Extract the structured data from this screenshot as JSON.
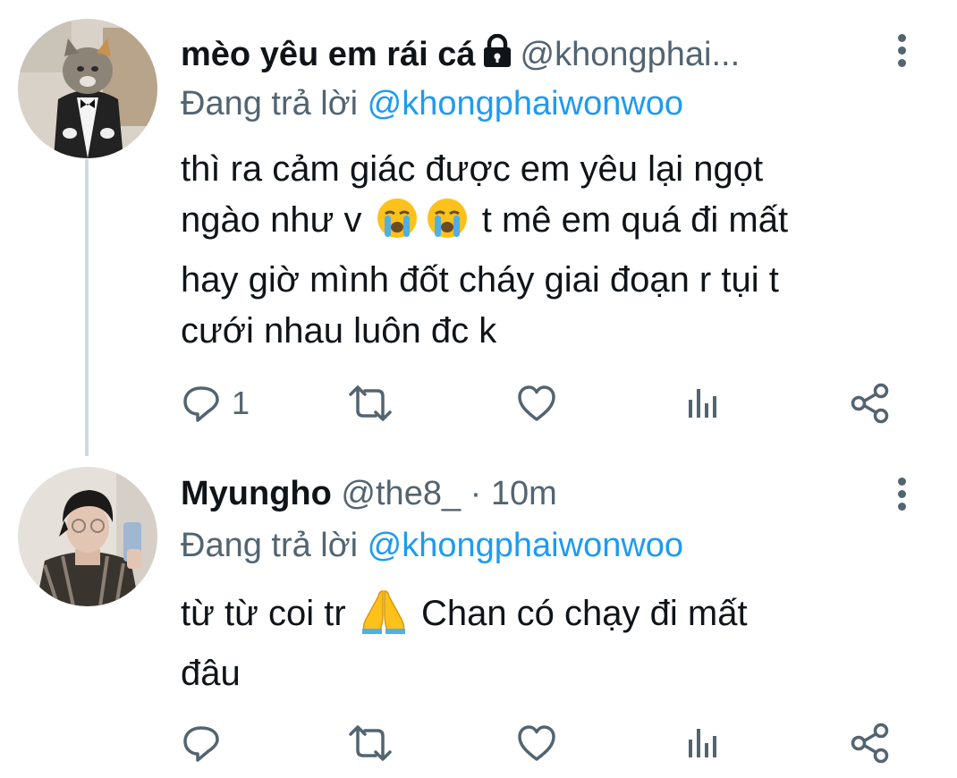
{
  "tweets": [
    {
      "display_name": "mèo yêu em rái cá",
      "handle": "@khongphai...",
      "time": "",
      "reply_label": "Đang trả lời",
      "reply_mention": "@khongphaiwonwoo",
      "text_line1": "thì ra cảm giác được em yêu lại ngọt",
      "text_line2_a": "ngào như v",
      "text_line2_b": "t mê em quá đi mất",
      "text_line3": "hay giờ mình đốt cháy giai đoạn r tụi t",
      "text_line4": "cưới nhau luôn đc k",
      "reply_count": "1",
      "emoji": [
        "loudly-crying-face-icon",
        "loudly-crying-face-icon"
      ],
      "locked": true
    },
    {
      "display_name": "Myungho",
      "handle": "@the8_",
      "time": "· 10m",
      "reply_label": "Đang trả lời",
      "reply_mention": "@khongphaiwonwoo",
      "text_line1_a": "từ từ coi tr",
      "text_line1_b": "Chan có chạy đi mất",
      "text_line2": "đâu",
      "reply_count": "",
      "emoji": [
        "folded-hands-icon"
      ],
      "locked": false
    }
  ],
  "colors": {
    "text": "#0f1419",
    "secondary": "#536471",
    "link": "#1d9bf0",
    "thread_line": "#cfd9de",
    "background": "#ffffff"
  }
}
